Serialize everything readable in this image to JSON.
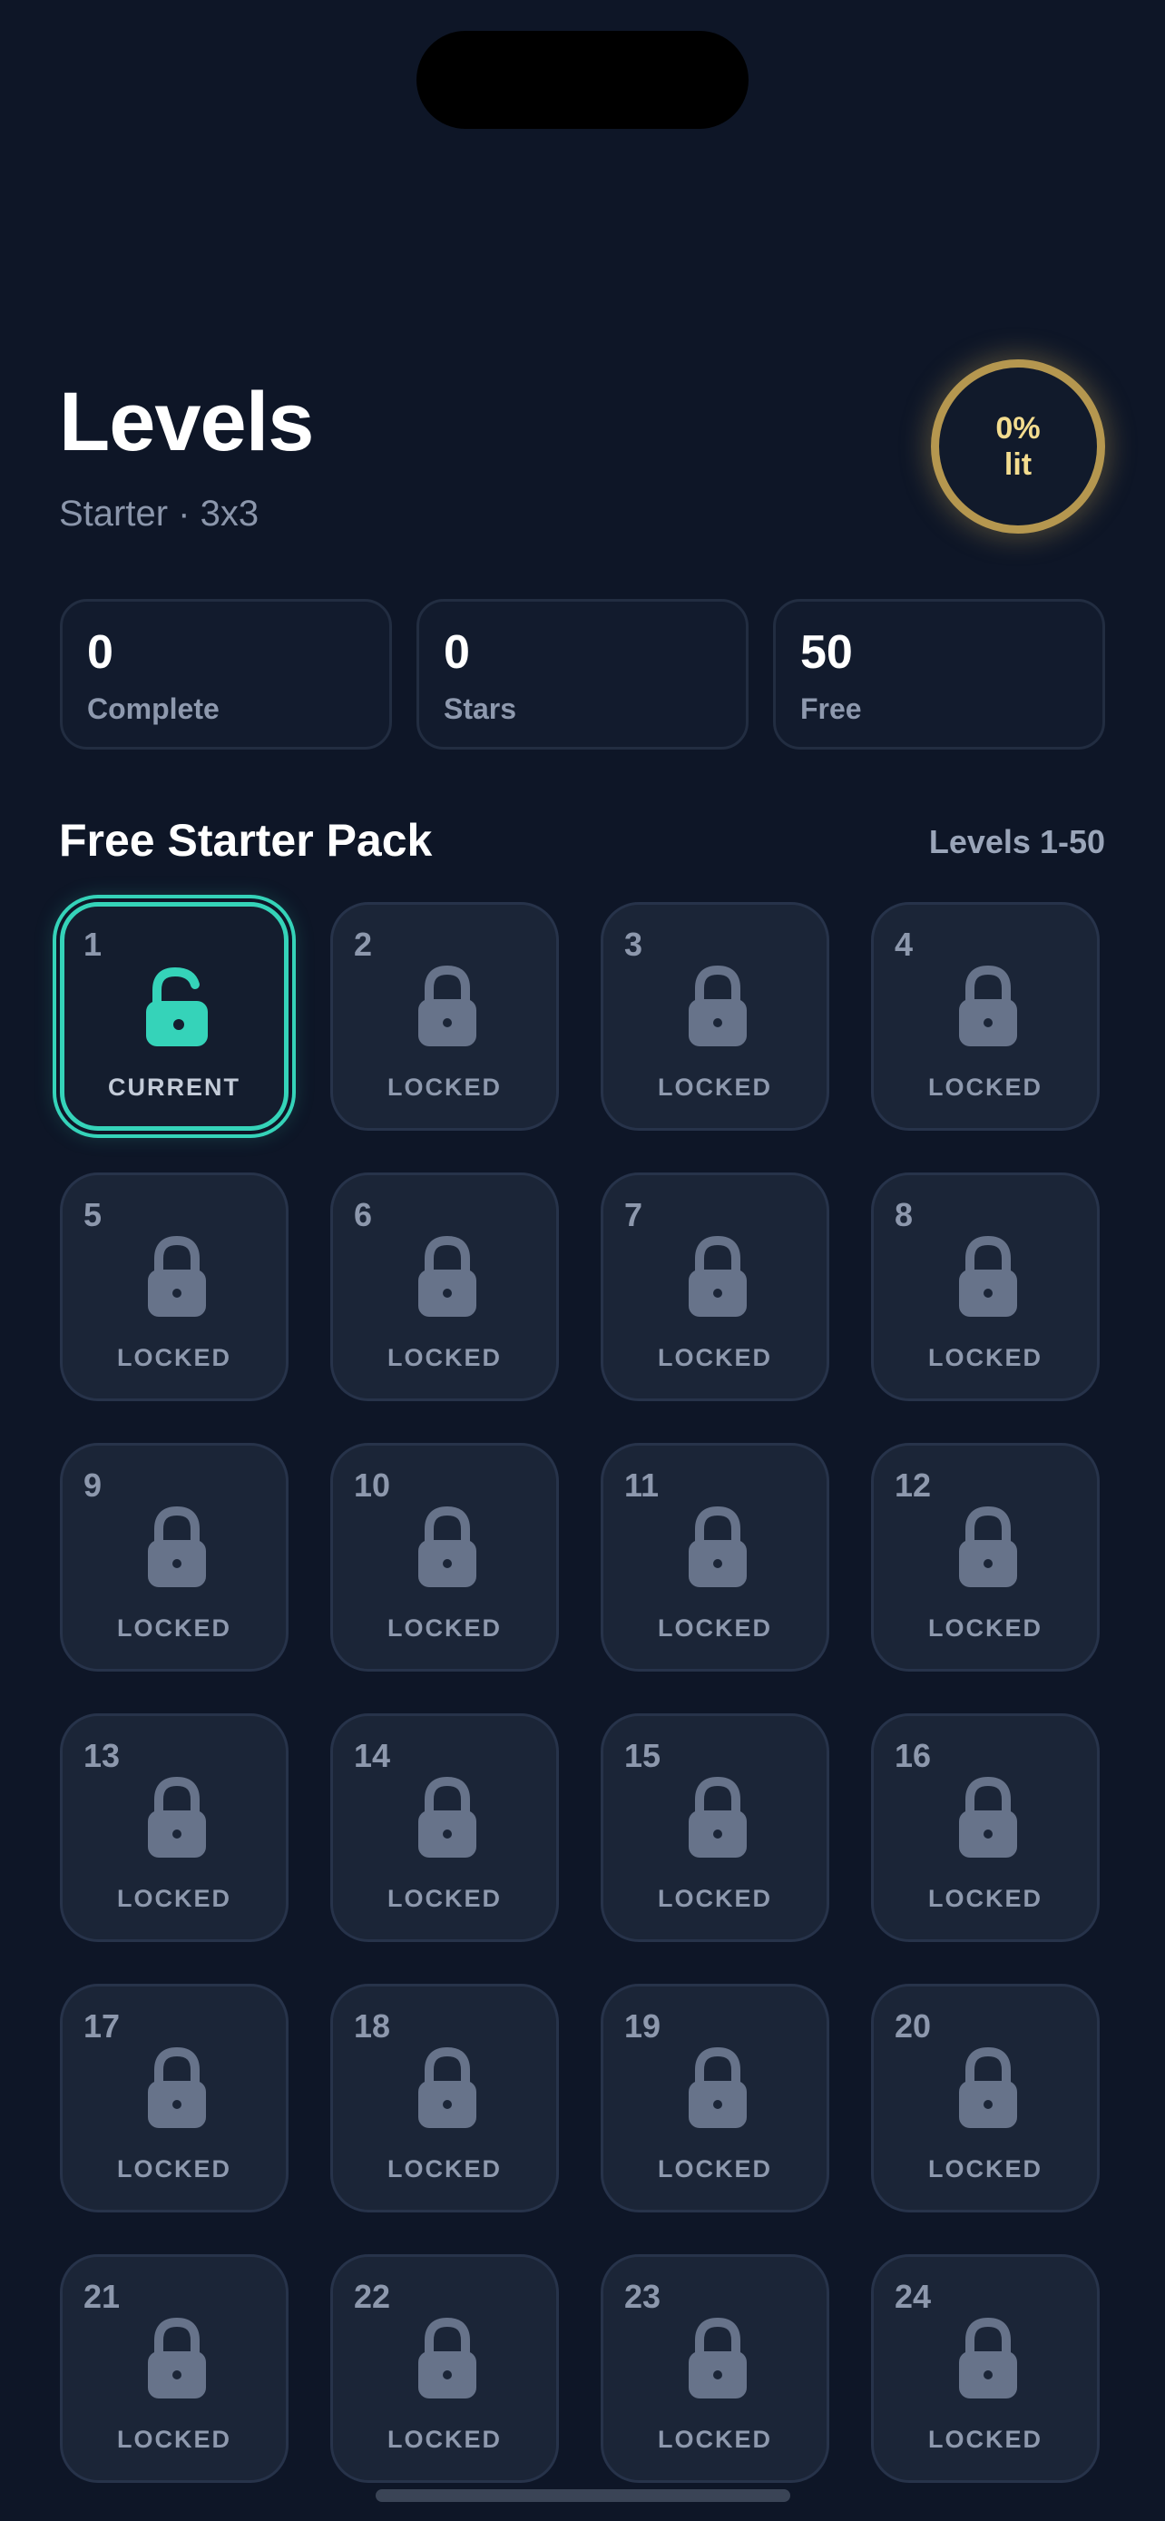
{
  "header": {
    "title": "Levels",
    "subtitle": "Starter · 3x3",
    "progress_label_line1": "0%",
    "progress_label_line2": "lit",
    "progress_value": 0
  },
  "stats": [
    {
      "value": "0",
      "label": "Complete"
    },
    {
      "value": "0",
      "label": "Stars"
    },
    {
      "value": "50",
      "label": "Free"
    }
  ],
  "pack": {
    "title": "Free Starter Pack",
    "range": "Levels 1-50"
  },
  "levels": [
    {
      "number": "1",
      "status": "CURRENT",
      "state": "current"
    },
    {
      "number": "2",
      "status": "LOCKED",
      "state": "locked"
    },
    {
      "number": "3",
      "status": "LOCKED",
      "state": "locked"
    },
    {
      "number": "4",
      "status": "LOCKED",
      "state": "locked"
    },
    {
      "number": "5",
      "status": "LOCKED",
      "state": "locked"
    },
    {
      "number": "6",
      "status": "LOCKED",
      "state": "locked"
    },
    {
      "number": "7",
      "status": "LOCKED",
      "state": "locked"
    },
    {
      "number": "8",
      "status": "LOCKED",
      "state": "locked"
    },
    {
      "number": "9",
      "status": "LOCKED",
      "state": "locked"
    },
    {
      "number": "10",
      "status": "LOCKED",
      "state": "locked"
    },
    {
      "number": "11",
      "status": "LOCKED",
      "state": "locked"
    },
    {
      "number": "12",
      "status": "LOCKED",
      "state": "locked"
    },
    {
      "number": "13",
      "status": "LOCKED",
      "state": "locked"
    },
    {
      "number": "14",
      "status": "LOCKED",
      "state": "locked"
    },
    {
      "number": "15",
      "status": "LOCKED",
      "state": "locked"
    },
    {
      "number": "16",
      "status": "LOCKED",
      "state": "locked"
    },
    {
      "number": "17",
      "status": "LOCKED",
      "state": "locked"
    },
    {
      "number": "18",
      "status": "LOCKED",
      "state": "locked"
    },
    {
      "number": "19",
      "status": "LOCKED",
      "state": "locked"
    },
    {
      "number": "20",
      "status": "LOCKED",
      "state": "locked"
    },
    {
      "number": "21",
      "status": "LOCKED",
      "state": "locked"
    },
    {
      "number": "22",
      "status": "LOCKED",
      "state": "locked"
    },
    {
      "number": "23",
      "status": "LOCKED",
      "state": "locked"
    },
    {
      "number": "24",
      "status": "LOCKED",
      "state": "locked"
    }
  ],
  "icons": {
    "locked": "lock-icon",
    "current": "unlocked-lock-icon"
  },
  "colors": {
    "background": "#0e1627",
    "accent": "#35d3b9",
    "progress_ring": "#b5974f",
    "progress_text": "#f3dc8f",
    "tile": "#1b2537",
    "lock": "#67738a"
  }
}
